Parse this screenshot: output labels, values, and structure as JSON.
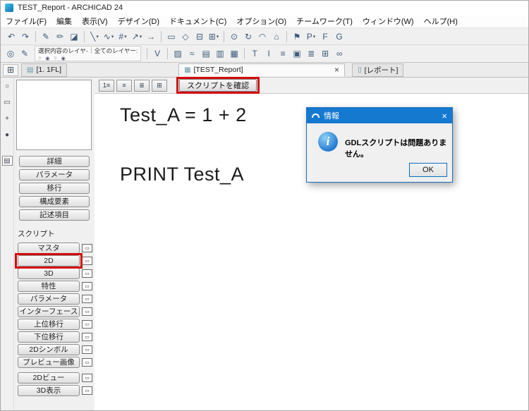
{
  "window": {
    "title": "TEST_Report - ARCHICAD 24"
  },
  "menu": {
    "items": [
      "ファイル(F)",
      "編集",
      "表示(V)",
      "デザイン(D)",
      "ドキュメント(C)",
      "オプション(O)",
      "チームワーク(T)",
      "ウィンドウ(W)",
      "ヘルプ(H)"
    ]
  },
  "glyphs": {
    "dropdown": "▾"
  },
  "toolbar_main": {
    "icons": [
      {
        "name": "undo-icon",
        "glyph": "↶"
      },
      {
        "name": "redo-icon",
        "glyph": "↷"
      },
      {
        "name": "highlighter-icon",
        "glyph": "✎"
      },
      {
        "name": "pencil-icon",
        "glyph": "✏"
      },
      {
        "name": "eraser-icon",
        "glyph": "◪"
      },
      {
        "name": "line-tool-icon",
        "glyph": "╲"
      },
      {
        "name": "spline-tool-icon",
        "glyph": "∿"
      },
      {
        "name": "grid-snap-icon",
        "glyph": "#"
      },
      {
        "name": "arrow-tool-icon",
        "glyph": "↗"
      },
      {
        "name": "offset-icon",
        "glyph": "→"
      },
      {
        "name": "marquee-icon",
        "glyph": "▭"
      },
      {
        "name": "wand-icon",
        "glyph": "◇"
      },
      {
        "name": "split-icon",
        "glyph": "⊟"
      },
      {
        "name": "merge-icon",
        "glyph": "⊞"
      },
      {
        "name": "zoom-icon",
        "glyph": "⊙"
      },
      {
        "name": "rotate-icon",
        "glyph": "↻"
      },
      {
        "name": "arc-icon",
        "glyph": "◠"
      },
      {
        "name": "home-icon",
        "glyph": "⌂"
      },
      {
        "name": "flag-icon",
        "glyph": "⚑"
      },
      {
        "name": "favorites-icon",
        "glyph": "P"
      },
      {
        "name": "profile-icon",
        "glyph": "F"
      },
      {
        "name": "capture-icon",
        "glyph": "G"
      }
    ]
  },
  "toolbar_second": {
    "icons_left": [
      {
        "name": "renovation-icon",
        "glyph": "◎"
      },
      {
        "name": "pen-set-icon",
        "glyph": "✎"
      }
    ],
    "layer_block": {
      "label_selected": "選択内容のレイヤ-",
      "label_all": "全てのレイヤー:"
    },
    "layer_icons": [
      {
        "name": "lock-icon",
        "glyph": "○"
      },
      {
        "name": "visibility-icon",
        "glyph": "◉"
      },
      {
        "name": "lock-icon",
        "glyph": "○"
      },
      {
        "name": "visibility-icon",
        "glyph": "◉"
      }
    ],
    "trace_icon": {
      "name": "trace-reference-icon",
      "glyph": "V"
    },
    "tools": [
      {
        "name": "fill-tool-icon",
        "glyph": "▨"
      },
      {
        "name": "wave-tool-icon",
        "glyph": "≈"
      },
      {
        "name": "hatch-tool-icon",
        "glyph": "▤"
      },
      {
        "name": "profile-tool-icon",
        "glyph": "▥"
      },
      {
        "name": "mesh-tool-icon",
        "glyph": "▦"
      },
      {
        "name": "text-tool-icon",
        "glyph": "T"
      },
      {
        "name": "column-tool-icon",
        "glyph": "I"
      },
      {
        "name": "beam-tool-icon",
        "glyph": "≡"
      },
      {
        "name": "object-tool-icon",
        "glyph": "▣"
      },
      {
        "name": "stair-tool-icon",
        "glyph": "≣"
      },
      {
        "name": "window-tool-icon",
        "glyph": "⊞"
      },
      {
        "name": "link-icon",
        "glyph": "∞"
      }
    ]
  },
  "tabbar": {
    "quad_icon": {
      "name": "quad-view-icon",
      "glyph": "⊞"
    },
    "tabs": [
      {
        "icon": "▤",
        "label": "[1. 1FL]"
      },
      {
        "icon": "▦",
        "label": "[TEST_Report]",
        "close": "×"
      },
      {
        "icon": "▯",
        "label": "[レポート]"
      }
    ]
  },
  "side_strip": {
    "icons": [
      {
        "name": "arrow-mode-icon",
        "glyph": "○"
      },
      {
        "name": "marquee-mode-icon",
        "glyph": "▭"
      },
      {
        "name": "pin-icon",
        "glyph": "+"
      },
      {
        "name": "globe-icon",
        "glyph": "●"
      },
      {
        "name": "grid-view-icon",
        "glyph": "▤"
      }
    ]
  },
  "left_panel": {
    "buttons": [
      "詳細",
      "パラメータ",
      "移行",
      "構成要素",
      "記述項目"
    ],
    "script_label": "スクリプト",
    "script_buttons": [
      "マスタ",
      "2D",
      "3D",
      "特性",
      "パラメータ",
      "インターフェース",
      "上位移行",
      "下位移行",
      "2Dシンボル",
      "プレビュー画像",
      "2Dビュー",
      "3D表示"
    ],
    "window_icon_glyph": "▭"
  },
  "script_toolbar": {
    "icons": [
      {
        "name": "line-numbers-icon",
        "glyph": "1≡"
      },
      {
        "name": "wrap-lines-icon",
        "glyph": "≡"
      },
      {
        "name": "indent-icon",
        "glyph": "≣"
      },
      {
        "name": "outline-icon",
        "glyph": "⊞"
      }
    ],
    "check_button": "スクリプトを確認"
  },
  "editor": {
    "lines": [
      "Test_A = 1 + 2",
      "PRINT Test_A"
    ]
  },
  "dialog": {
    "title": "情報",
    "close": "×",
    "info_glyph": "i",
    "message": "GDLスクリプトは問題ありません。",
    "ok_label": "OK"
  }
}
